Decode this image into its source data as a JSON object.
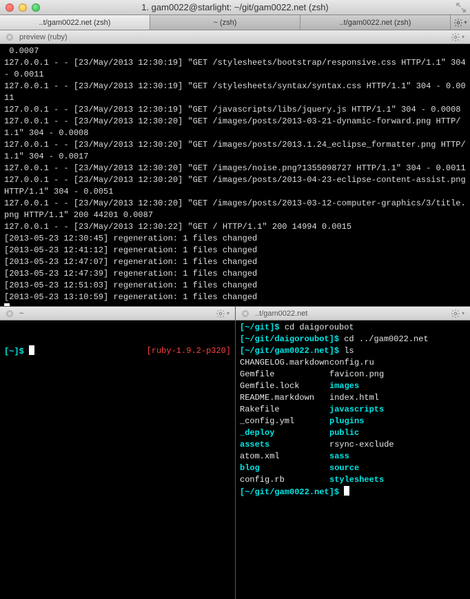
{
  "window": {
    "title": "1. gam0022@starlight: ~/git/gam0022.net (zsh)"
  },
  "tabs": [
    {
      "label": "..t/gam0022.net (zsh)",
      "active": true
    },
    {
      "label": "~ (zsh)",
      "active": false
    },
    {
      "label": "..t/gam0022.net (zsh)",
      "active": false
    }
  ],
  "pane_top": {
    "title": "preview (ruby)"
  },
  "logs": [
    " 0.0007",
    "127.0.0.1 - - [23/May/2013 12:30:19] \"GET /stylesheets/bootstrap/responsive.css HTTP/1.1\" 304 - 0.0011",
    "127.0.0.1 - - [23/May/2013 12:30:19] \"GET /stylesheets/syntax/syntax.css HTTP/1.1\" 304 - 0.0011",
    "127.0.0.1 - - [23/May/2013 12:30:19] \"GET /javascripts/libs/jquery.js HTTP/1.1\" 304 - 0.0008",
    "127.0.0.1 - - [23/May/2013 12:30:20] \"GET /images/posts/2013-03-21-dynamic-forward.png HTTP/1.1\" 304 - 0.0008",
    "127.0.0.1 - - [23/May/2013 12:30:20] \"GET /images/posts/2013.1.24_eclipse_formatter.png HTTP/1.1\" 304 - 0.0017",
    "127.0.0.1 - - [23/May/2013 12:30:20] \"GET /images/noise.png?1355098727 HTTP/1.1\" 304 - 0.0011",
    "127.0.0.1 - - [23/May/2013 12:30:20] \"GET /images/posts/2013-04-23-eclipse-content-assist.png HTTP/1.1\" 304 - 0.0051",
    "127.0.0.1 - - [23/May/2013 12:30:20] \"GET /images/posts/2013-03-12-computer-graphics/3/title.png HTTP/1.1\" 200 44201 0.0087",
    "127.0.0.1 - - [23/May/2013 12:30:22] \"GET / HTTP/1.1\" 200 14994 0.0015",
    "[2013-05-23 12:30:45] regeneration: 1 files changed",
    "[2013-05-23 12:41:12] regeneration: 1 files changed",
    "[2013-05-23 12:47:07] regeneration: 1 files changed",
    "[2013-05-23 12:47:39] regeneration: 1 files changed",
    "[2013-05-23 12:51:03] regeneration: 1 files changed",
    "[2013-05-23 13:10:59] regeneration: 1 files changed"
  ],
  "pane_left": {
    "title": "~",
    "prompt": "[~]$ ",
    "rvm": "[ruby-1.9.2-p320]"
  },
  "pane_right": {
    "title": "..t/gam0022.net",
    "lines": [
      {
        "prompt": "[~/git]$ ",
        "cmd": "cd daigoroubot"
      },
      {
        "prompt": "[~/git/daigoroubot]$ ",
        "cmd": "cd ../gam0022.net"
      },
      {
        "prompt": "[~/git/gam0022.net]$ ",
        "cmd": "ls"
      }
    ],
    "ls": [
      {
        "a": "CHANGELOG.markdown",
        "b": "config.ru",
        "ac": "w",
        "bc": "w"
      },
      {
        "a": "Gemfile",
        "b": "favicon.png",
        "ac": "w",
        "bc": "w"
      },
      {
        "a": "Gemfile.lock",
        "b": "images",
        "ac": "w",
        "bc": "c"
      },
      {
        "a": "README.markdown",
        "b": "index.html",
        "ac": "w",
        "bc": "w"
      },
      {
        "a": "Rakefile",
        "b": "javascripts",
        "ac": "w",
        "bc": "c"
      },
      {
        "a": "_config.yml",
        "b": "plugins",
        "ac": "w",
        "bc": "c"
      },
      {
        "a": "_deploy",
        "b": "public",
        "ac": "c",
        "bc": "c"
      },
      {
        "a": "assets",
        "b": "rsync-exclude",
        "ac": "c",
        "bc": "w"
      },
      {
        "a": "atom.xml",
        "b": "sass",
        "ac": "w",
        "bc": "c"
      },
      {
        "a": "blog",
        "b": "source",
        "ac": "c",
        "bc": "c"
      },
      {
        "a": "config.rb",
        "b": "stylesheets",
        "ac": "w",
        "bc": "c"
      }
    ],
    "final_prompt": "[~/git/gam0022.net]$ "
  }
}
